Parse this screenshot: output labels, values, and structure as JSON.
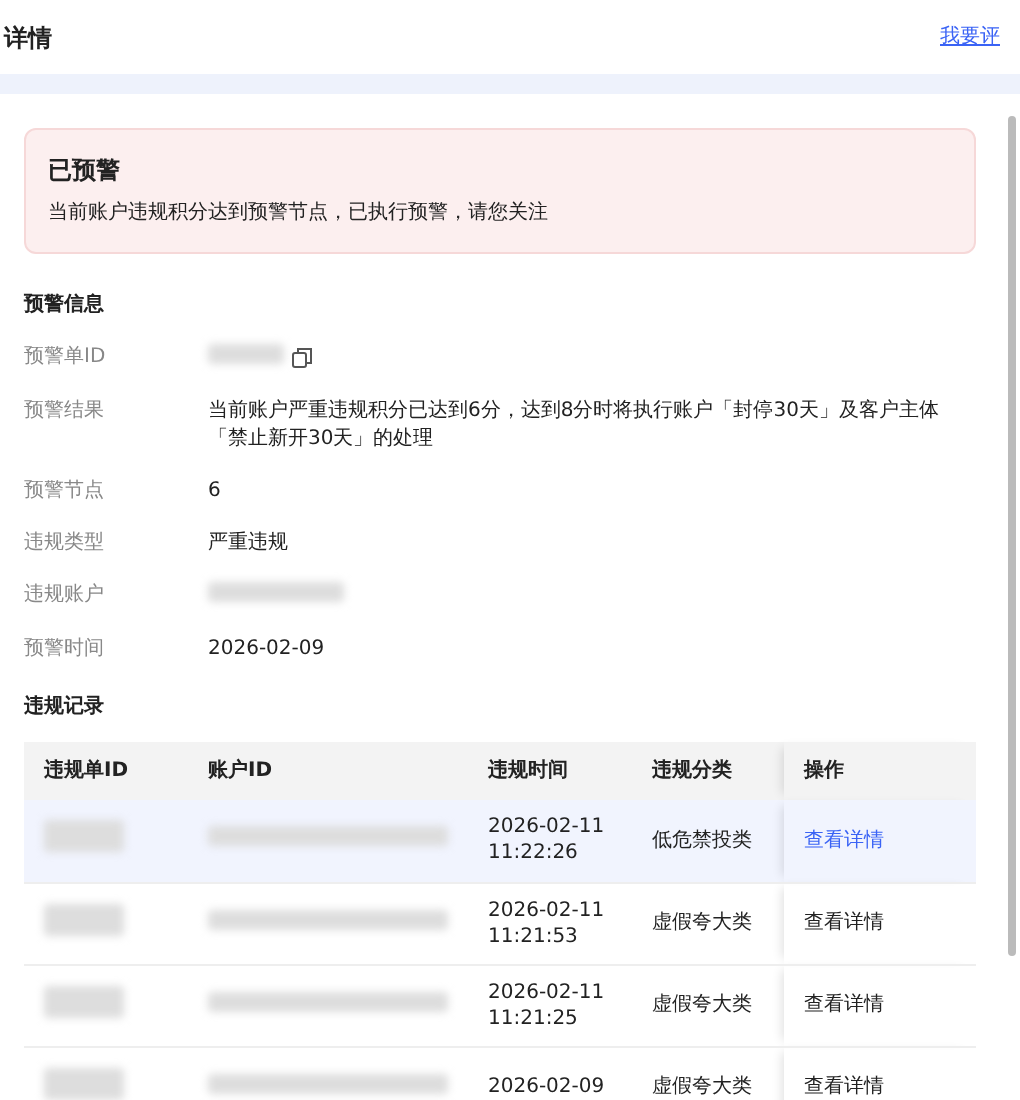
{
  "header": {
    "title": "详情",
    "link": "我要评"
  },
  "alert": {
    "title": "已预警",
    "message": "当前账户违规积分达到预警节点，已执行预警，请您关注"
  },
  "info": {
    "heading": "预警信息",
    "fields": [
      {
        "label": "预警单ID",
        "kind": "redacted"
      },
      {
        "label": "预警结果",
        "kind": "text",
        "value": "当前账户严重违规积分已达到6分，达到8分时将执行账户「封停30天」及客户主体「禁止新开30天」的处理"
      },
      {
        "label": "预警节点",
        "kind": "text",
        "value": "6"
      },
      {
        "label": "违规类型",
        "kind": "text",
        "value": "严重违规"
      },
      {
        "label": "违规账户",
        "kind": "redacted"
      },
      {
        "label": "预警时间",
        "kind": "text",
        "value": "2026-02-09"
      }
    ]
  },
  "records": {
    "heading": "违规记录",
    "columns": [
      "违规单ID",
      "账户ID",
      "违规时间",
      "违规分类",
      "操作"
    ],
    "rows": [
      {
        "date": "2026-02-11",
        "time": "11:22:26",
        "category": "低危禁投类",
        "action": "查看详情",
        "selected": true
      },
      {
        "date": "2026-02-11",
        "time": "11:21:53",
        "category": "虚假夸大类",
        "action": "查看详情",
        "selected": false
      },
      {
        "date": "2026-02-11",
        "time": "11:21:25",
        "category": "虚假夸大类",
        "action": "查看详情",
        "selected": false
      },
      {
        "date": "2026-02-09",
        "category": "虚假夸大类",
        "action": "查看详情",
        "selected": false
      }
    ]
  }
}
